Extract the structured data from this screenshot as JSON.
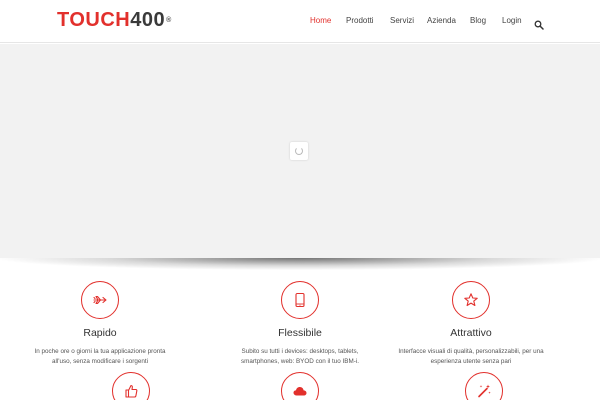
{
  "logo": {
    "text_red": "TOUCH",
    "text_dark": "400",
    "mark": "®"
  },
  "nav": {
    "items": [
      {
        "label": "Home",
        "active": true
      },
      {
        "label": "Prodotti",
        "active": false
      },
      {
        "label": "Servizi",
        "active": false
      },
      {
        "label": "Azienda",
        "active": false
      },
      {
        "label": "Blog",
        "active": false
      },
      {
        "label": "Login",
        "active": false
      }
    ],
    "search_icon": "search-icon"
  },
  "colors": {
    "accent": "#e2302c",
    "slider_bg": "#f2f2f2",
    "text": "#333333"
  },
  "features": [
    {
      "icon": "airplane-icon",
      "title": "Rapido",
      "desc_line1": "In poche ore o giorni la tua applicazione pronta",
      "desc_line2": "all'uso, senza modificare i sorgenti"
    },
    {
      "icon": "tablet-icon",
      "title": "Flessibile",
      "desc_line1": "Subito su tutti i devices: desktops, tablets,",
      "desc_line2": "smartphones, web: BYOD con il tuo IBM-i."
    },
    {
      "icon": "star-icon",
      "title": "Attrattivo",
      "desc_line1": "Interfacce visuali di qualità, personalizzabili, per una",
      "desc_line2": "esperienza utente senza pari"
    },
    {
      "icon": "thumbs-up-icon"
    },
    {
      "icon": "cloud-icon"
    },
    {
      "icon": "magic-wand-icon"
    }
  ]
}
